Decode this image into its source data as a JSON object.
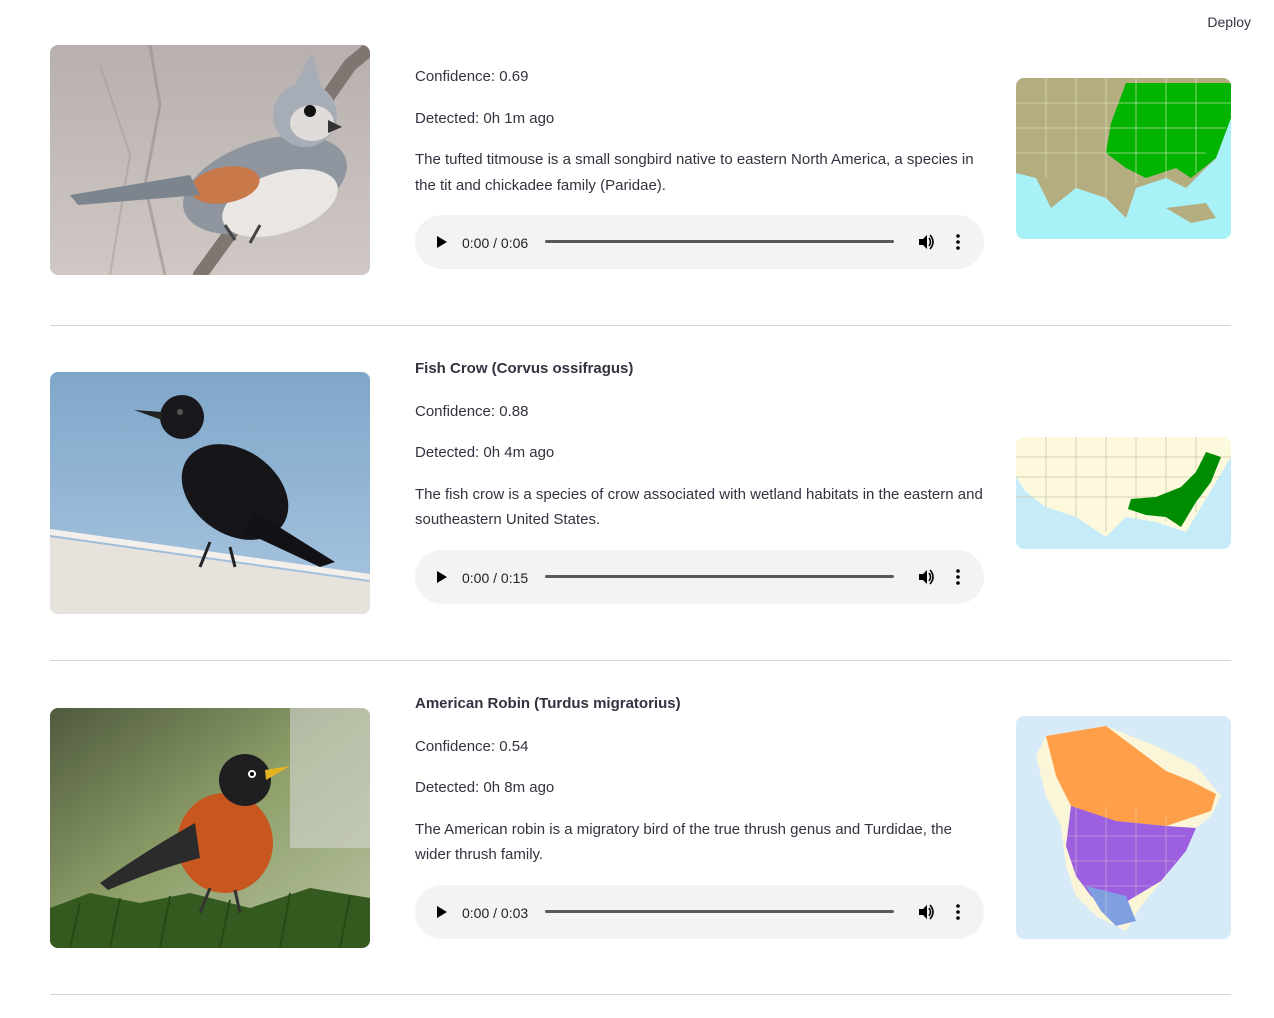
{
  "header": {
    "deploy_label": "Deploy"
  },
  "detections": [
    {
      "name": "",
      "confidence": "Confidence: 0.69",
      "detected": "Detected: 0h 1m ago",
      "description": "The tufted titmouse is a small songbird native to eastern North America, a species in the tit and chickadee family (Paridae).",
      "audio_time": "0:00 / 0:06"
    },
    {
      "name": "Fish Crow (Corvus ossifragus)",
      "confidence": "Confidence: 0.88",
      "detected": "Detected: 0h 4m ago",
      "description": "The fish crow is a species of crow associated with wetland habitats in the eastern and southeastern United States.",
      "audio_time": "0:00 / 0:15"
    },
    {
      "name": "American Robin (Turdus migratorius)",
      "confidence": "Confidence: 0.54",
      "detected": "Detected: 0h 8m ago",
      "description": "The American robin is a migratory bird of the true thrush genus and Turdidae, the wider thrush family.",
      "audio_time": "0:00 / 0:03"
    }
  ],
  "icons": {
    "play": "play-icon",
    "volume": "volume-icon",
    "menu": "more-vertical-icon"
  },
  "colors": {
    "audio_bg": "#f1f3f4",
    "range_titmouse": "#00b400",
    "range_crow": "#008c00",
    "range_robin_breeding": "#ff9f4a",
    "range_robin_year_round": "#9b5fe0",
    "range_robin_winter": "#7f9fe0"
  }
}
